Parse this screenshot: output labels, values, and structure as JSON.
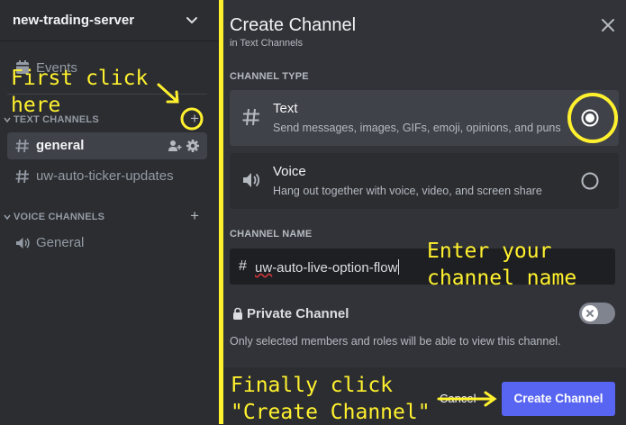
{
  "sidebar": {
    "server_name": "new-trading-server",
    "events_label": "Events",
    "text_category": "TEXT CHANNELS",
    "voice_category": "VOICE CHANNELS",
    "text_channels": [
      "general",
      "uw-auto-ticker-updates"
    ],
    "voice_channels": [
      "General"
    ]
  },
  "modal": {
    "title": "Create Channel",
    "subtitle": "in Text Channels",
    "channel_type_label": "CHANNEL TYPE",
    "options": [
      {
        "title": "Text",
        "description": "Send messages, images, GIFs, emoji, opinions, and puns",
        "selected": true
      },
      {
        "title": "Voice",
        "description": "Hang out together with voice, video, and screen share",
        "selected": false
      }
    ],
    "channel_name_label": "CHANNEL NAME",
    "channel_name_prefix": "#",
    "channel_name_value_underlined": "uw",
    "channel_name_value_rest": "-auto-live-option-flow",
    "private_label": "Private Channel",
    "private_enabled": false,
    "private_description": "Only selected members and roles will be able to view this channel.",
    "cancel_label": "Cancel",
    "create_label": "Create Channel"
  },
  "annotations": {
    "step1_line1": "First click",
    "step1_line2": "here",
    "step2_line1": "Enter your",
    "step2_line2": "channel name",
    "step3_line1": "Finally click",
    "step3_line2": "\"Create Channel\""
  },
  "colors": {
    "annotation": "#fff12e",
    "accent": "#5865f2",
    "sidebar_bg": "#2b2d31",
    "modal_bg": "#313338"
  }
}
